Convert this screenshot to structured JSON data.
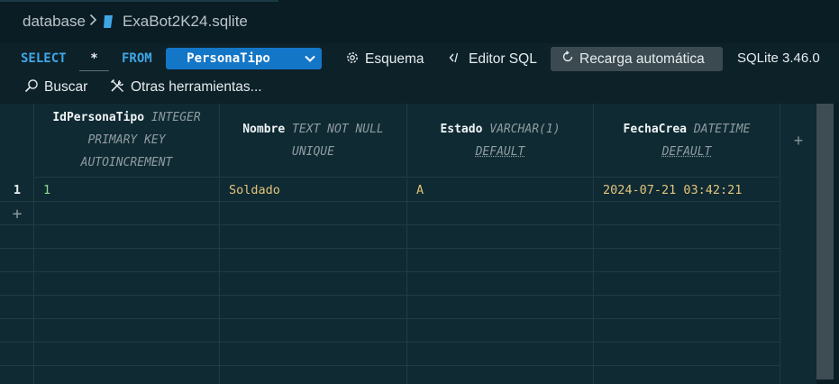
{
  "breadcrumb": {
    "folder": "database",
    "file": "ExaBot2K24.sqlite"
  },
  "toolbar": {
    "select_kw": "SELECT",
    "star": "*",
    "from_kw": "FROM",
    "table": "PersonaTipo",
    "schema": "Esquema",
    "sql_editor": "Editor SQL",
    "auto_reload": "Recarga automática",
    "version": "SQLite 3.46.0",
    "search": "Buscar",
    "other_tools": "Otras herramientas..."
  },
  "columns": [
    {
      "name": "IdPersonaTipo",
      "type_lines": [
        "INTEGER",
        "PRIMARY KEY",
        "AUTOINCREMENT"
      ]
    },
    {
      "name": "Nombre",
      "type_lines": [
        "TEXT NOT NULL",
        "UNIQUE"
      ]
    },
    {
      "name": "Estado",
      "type_lines": [
        "VARCHAR(1)",
        "DEFAULT"
      ]
    },
    {
      "name": "FechaCrea",
      "type_lines": [
        "DATETIME",
        "DEFAULT"
      ]
    }
  ],
  "rows": [
    {
      "num": "1",
      "cells": [
        "1",
        "Soldado",
        "A",
        "2024-07-21 03:42:21"
      ]
    }
  ],
  "add_row": "+",
  "add_column": "+",
  "colors": {
    "accent": "#1476c7",
    "keyword": "#3fa7e6",
    "number": "#8fd98f",
    "string": "#e3c37a"
  },
  "icons": {
    "file": "file-icon",
    "schema": "gear-icon",
    "sql": "code-icon",
    "reload": "reload-icon",
    "search": "search-icon",
    "tools": "tools-icon",
    "dropdown": "chevron-down-icon"
  }
}
